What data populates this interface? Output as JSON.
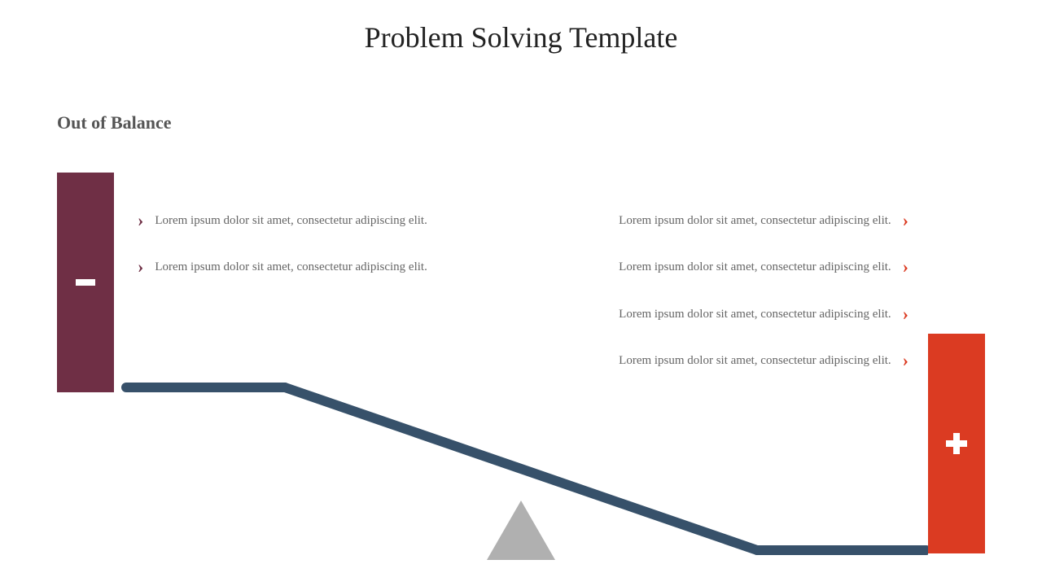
{
  "title": "Problem Solving Template",
  "subtitle": "Out of Balance",
  "negative": {
    "items": [
      "Lorem ipsum dolor sit amet, consectetur adipiscing elit.",
      "Lorem ipsum dolor sit amet, consectetur adipiscing elit."
    ]
  },
  "positive": {
    "items": [
      "Lorem ipsum dolor sit amet, consectetur adipiscing elit.",
      "Lorem ipsum dolor sit amet, consectetur adipiscing elit.",
      "Lorem ipsum dolor sit amet, consectetur adipiscing elit.",
      "Lorem ipsum dolor sit amet, consectetur adipiscing elit."
    ]
  },
  "colors": {
    "negative": "#6f2f45",
    "positive": "#db3b22",
    "beam": "#37516a",
    "fulcrum": "#b0b0b0"
  }
}
